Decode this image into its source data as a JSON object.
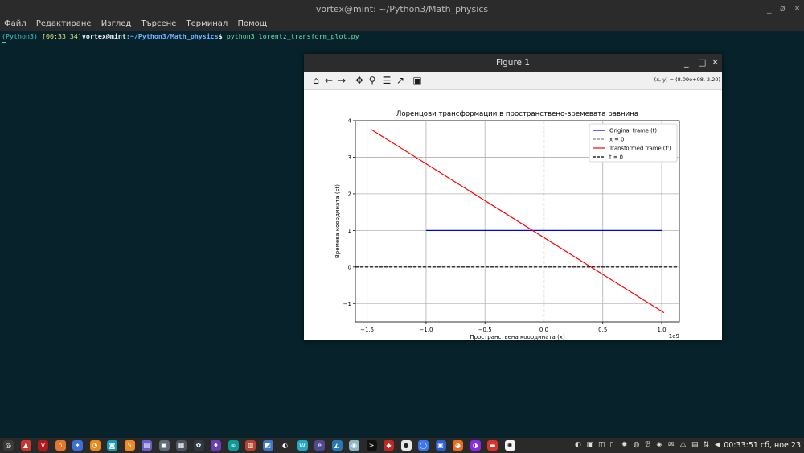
{
  "window": {
    "title": "vortex@mint: ~/Python3/Math_physics",
    "controls": [
      "_",
      "ø",
      "✕"
    ]
  },
  "menu": [
    "Файл",
    "Редактиране",
    "Изглед",
    "Търсене",
    "Терминал",
    "Помощ"
  ],
  "terminal": {
    "env": "(Python3)",
    "time": "[00:33:34]",
    "user": "vortex@mint",
    "path": ":~/Python3/Math_physics",
    "prompt": "$",
    "command": " python3 lorentz_transform_plot.py"
  },
  "figure": {
    "title": "Figure 1",
    "controls": [
      "_",
      "□",
      "✕"
    ],
    "coords": "(x, y) = (8.09e+08, 2.20)"
  },
  "chart_data": {
    "type": "line",
    "title": "Лоренцови трансформации в пространствено-времевата равнина",
    "xlabel": "Пространствена координата (x)",
    "ylabel": "Времева координата (ct)",
    "xlim": [
      -1600000000.0,
      1150000000.0
    ],
    "ylim": [
      -1.5,
      4
    ],
    "x_offset_label": "1e9",
    "xticks": [
      -1500000000.0,
      -1000000000.0,
      -500000000.0,
      0,
      500000000.0,
      1000000000.0
    ],
    "xtick_labels": [
      "−1.5",
      "−1.0",
      "−0.5",
      "0.0",
      "0.5",
      "1.0"
    ],
    "yticks": [
      -1,
      0,
      1,
      2,
      3,
      4
    ],
    "ytick_labels": [
      "−1",
      "0",
      "1",
      "2",
      "3",
      "4"
    ],
    "grid": true,
    "legend_position": "top-right",
    "series": [
      {
        "name": "Original frame (t)",
        "color": "#0000ff",
        "style": "solid",
        "x": [
          -1000000000.0,
          1000000000.0
        ],
        "y": [
          1,
          1
        ]
      },
      {
        "name": "x = 0",
        "color": "#808080",
        "style": "dashed",
        "x": [
          0,
          0
        ],
        "y": [
          -1.5,
          4
        ]
      },
      {
        "name": "Transformed frame (t')",
        "color": "#ff0000",
        "style": "solid",
        "x": [
          -1470000000.0,
          1020000000.0
        ],
        "y": [
          3.77,
          -1.25
        ]
      },
      {
        "name": "t = 0",
        "color": "#000000",
        "style": "dashed",
        "x": [
          -1600000000.0,
          1150000000.0
        ],
        "y": [
          0,
          0
        ]
      }
    ]
  },
  "taskbar": {
    "clock": "00:33:51 сб, ное 23",
    "apps": [
      {
        "name": "menu-icon",
        "color": "#3b3b3b",
        "glyph": "◎"
      },
      {
        "name": "app-red-icon",
        "color": "#c6382b",
        "glyph": "▲"
      },
      {
        "name": "vivaldi-icon",
        "color": "#b01a1a",
        "glyph": "V"
      },
      {
        "name": "files-orange-icon",
        "color": "#e4762d",
        "glyph": "∩"
      },
      {
        "name": "app-blue-icon",
        "color": "#3c6fd8",
        "glyph": "✦"
      },
      {
        "name": "blender-icon",
        "color": "#e98a1c",
        "glyph": "◔"
      },
      {
        "name": "app-teal-icon",
        "color": "#18a0b2",
        "glyph": "◙"
      },
      {
        "name": "sublime-icon",
        "color": "#f08a25",
        "glyph": "S"
      },
      {
        "name": "app-purple-icon",
        "color": "#6b5fc9",
        "glyph": "▤"
      },
      {
        "name": "app-grey-icon",
        "color": "#5e6a7a",
        "glyph": "▣"
      },
      {
        "name": "app-box-icon",
        "color": "#4b5563",
        "glyph": "▦"
      },
      {
        "name": "app-white-icon",
        "color": "#2f3a44",
        "glyph": "✿"
      },
      {
        "name": "app-violet-icon",
        "color": "#6a3fb5",
        "glyph": "♦"
      },
      {
        "name": "arduino-icon",
        "color": "#0f9a9a",
        "glyph": "∞"
      },
      {
        "name": "app-brick-icon",
        "color": "#b8432e",
        "glyph": "▥"
      },
      {
        "name": "app-image-icon",
        "color": "#3e79c7",
        "glyph": "◩"
      },
      {
        "name": "app-circle-icon",
        "color": "#2b2b2b",
        "glyph": "◐"
      },
      {
        "name": "app-wave-icon",
        "color": "#22a7c5",
        "glyph": "W"
      },
      {
        "name": "eclipse-icon",
        "color": "#4d4a8f",
        "glyph": "e"
      },
      {
        "name": "app-chart-icon",
        "color": "#2379b9",
        "glyph": "◭"
      },
      {
        "name": "app-eye-icon",
        "color": "#8bb7c9",
        "glyph": "◉"
      },
      {
        "name": "terminal-icon",
        "color": "#111111",
        "glyph": ">"
      },
      {
        "name": "app-red2-icon",
        "color": "#c2271f",
        "glyph": "◆"
      },
      {
        "name": "app-chat-icon",
        "color": "#e8e8e8",
        "glyph": "●"
      },
      {
        "name": "signal-icon",
        "color": "#3a76f0",
        "glyph": "◯"
      },
      {
        "name": "app-blue2-icon",
        "color": "#2d5fd0",
        "glyph": "▣"
      },
      {
        "name": "firefox-icon",
        "color": "#ea6c1e",
        "glyph": "◕"
      },
      {
        "name": "app-pink-icon",
        "color": "#8a2be2",
        "glyph": "◑"
      },
      {
        "name": "folder-red-icon",
        "color": "#d9342b",
        "glyph": "▬"
      },
      {
        "name": "app-pinwheel-icon",
        "color": "#f3f3f3",
        "glyph": "✺"
      }
    ],
    "tray": [
      {
        "name": "tray-1-icon",
        "glyph": "◐"
      },
      {
        "name": "tray-2-icon",
        "glyph": "▣"
      },
      {
        "name": "tray-3-icon",
        "glyph": "◫"
      },
      {
        "name": "tray-4-icon",
        "glyph": "▯"
      },
      {
        "name": "tray-5-icon",
        "glyph": "✹"
      },
      {
        "name": "tray-6-icon",
        "glyph": "◍"
      },
      {
        "name": "tray-7-icon",
        "glyph": "ℬ"
      },
      {
        "name": "tray-8-icon",
        "glyph": "◈"
      },
      {
        "name": "tray-9-icon",
        "glyph": "✉"
      },
      {
        "name": "tray-10-icon",
        "glyph": "⚠"
      },
      {
        "name": "flag-icon",
        "glyph": "▤"
      },
      {
        "name": "tray-11-icon",
        "glyph": "⇅"
      },
      {
        "name": "volume-icon",
        "glyph": "◀"
      }
    ]
  }
}
